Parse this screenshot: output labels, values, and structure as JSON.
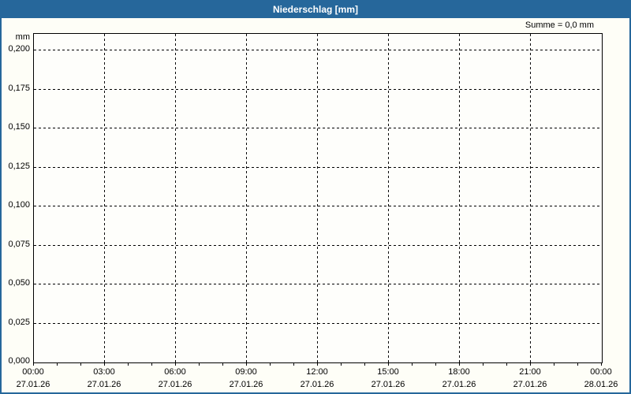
{
  "window": {
    "title": "Niederschlag [mm]"
  },
  "summary": {
    "label": "Summe = 0,0 mm"
  },
  "colors": {
    "frame": "#26679b",
    "titlebar_bg": "#26679b",
    "title_text": "#ffffff",
    "background": "#fefef7",
    "grid": "#000000",
    "text": "#000000"
  },
  "y_axis": {
    "unit": "mm",
    "tick_labels": [
      "0,200",
      "0,175",
      "0,150",
      "0,125",
      "0,100",
      "0,075",
      "0,050",
      "0,025",
      "0,000"
    ]
  },
  "x_axis": {
    "times": [
      "00:00",
      "03:00",
      "06:00",
      "09:00",
      "12:00",
      "15:00",
      "18:00",
      "21:00",
      "00:00"
    ],
    "dates": [
      "27.01.26",
      "27.01.26",
      "27.01.26",
      "27.01.26",
      "27.01.26",
      "27.01.26",
      "27.01.26",
      "27.01.26",
      "28.01.26"
    ]
  },
  "chart_data": {
    "type": "bar",
    "title": "Niederschlag [mm]",
    "ylabel": "mm",
    "ylim": [
      0.0,
      0.2
    ],
    "y_tick_step": 0.025,
    "x_range": [
      "27.01.26 00:00",
      "28.01.26 00:00"
    ],
    "x_major_tick_hours": 3,
    "x_minor_tick_hours": 1,
    "categories": [
      "27.01.26 00:00",
      "27.01.26 03:00",
      "27.01.26 06:00",
      "27.01.26 09:00",
      "27.01.26 12:00",
      "27.01.26 15:00",
      "27.01.26 18:00",
      "27.01.26 21:00",
      "28.01.26 00:00"
    ],
    "series": [
      {
        "name": "Niederschlag",
        "values": [
          0,
          0,
          0,
          0,
          0,
          0,
          0,
          0,
          0
        ]
      }
    ],
    "sum_mm": 0.0,
    "annotations": [
      "Summe = 0,0 mm"
    ],
    "grid": "dashed",
    "legend": "none"
  }
}
